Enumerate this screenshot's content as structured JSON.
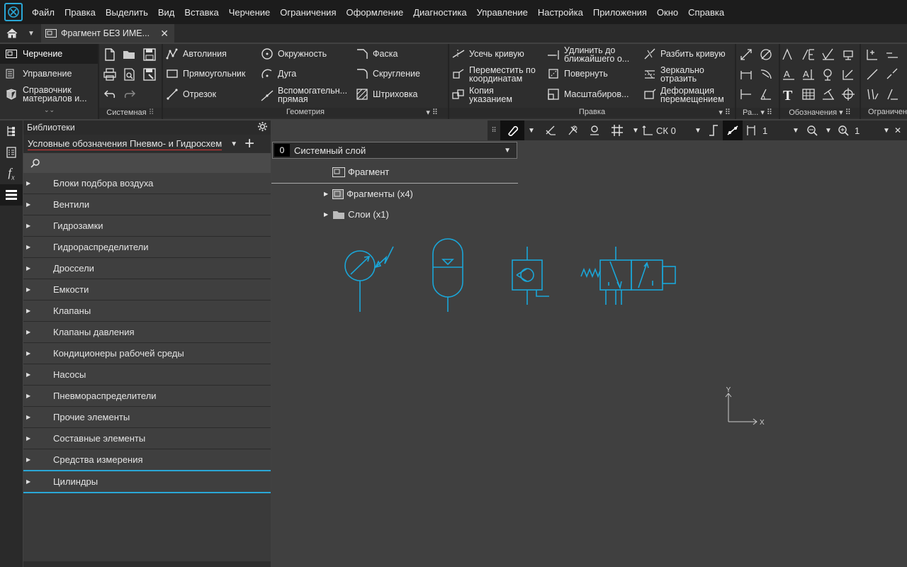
{
  "colors": {
    "accent": "#2aa7d6",
    "drawing": "#1aa6d8",
    "background": "#414141"
  },
  "menu": [
    "Файл",
    "Правка",
    "Выделить",
    "Вид",
    "Вставка",
    "Черчение",
    "Ограничения",
    "Оформление",
    "Диагностика",
    "Управление",
    "Настройка",
    "Приложения",
    "Окно",
    "Справка"
  ],
  "tabs": {
    "document": "Фрагмент БЕЗ ИМЕ..."
  },
  "ribbon": {
    "left": {
      "drawing": "Черчение",
      "management": "Управление",
      "reference_1": "Справочник",
      "reference_2": "материалов и..."
    },
    "groups": {
      "system": "Системная",
      "geometry": "Геометрия",
      "edit": "Правка",
      "dimensions": "Ра...",
      "designations": "Обозначения",
      "constraints": "Ограничен"
    },
    "geometry": {
      "autoline": "Автолиния",
      "rectangle": "Прямоугольник",
      "segment": "Отрезок",
      "circle": "Окружность",
      "arc": "Дуга",
      "aux_1": "Вспомогательн...",
      "aux_2": "прямая",
      "chamfer": "Фаска",
      "fillet": "Скругление",
      "hatch": "Штриховка"
    },
    "edit": {
      "trim": "Усечь кривую",
      "move_1": "Переместить по",
      "move_2": "координатам",
      "copy_1": "Копия",
      "copy_2": "указанием",
      "extend_1": "Удлинить до",
      "extend_2": "ближайшего о...",
      "rotate": "Повернуть",
      "scale": "Масштабиров...",
      "split": "Разбить кривую",
      "mirror_1": "Зеркально",
      "mirror_2": "отразить",
      "deform_1": "Деформация",
      "deform_2": "перемещением"
    }
  },
  "library": {
    "header": "Библиотеки",
    "selected": "Условные обозначения Пневмо- и Гидросхем",
    "items": [
      "Блоки подбора воздуха",
      "Вентили",
      "Гидрозамки",
      "Гидрораспределители",
      "Дроссели",
      "Емкости",
      "Клапаны",
      "Клапаны давления",
      "Кондиционеры рабочей среды",
      "Насосы",
      "Пневмораспределители",
      "Прочие элементы",
      "Составные элементы",
      "Средства измерения",
      "Цилиндры"
    ]
  },
  "viewbar": {
    "cs": "СК 0",
    "step": "1",
    "zoom": "1"
  },
  "layer": {
    "number": "0",
    "name": "Системный слой"
  },
  "tree": {
    "root": "Фрагмент",
    "fragments": "Фрагменты (x4)",
    "layers": "Слои (x1)"
  },
  "axes": {
    "x": "X",
    "y": "Y"
  }
}
